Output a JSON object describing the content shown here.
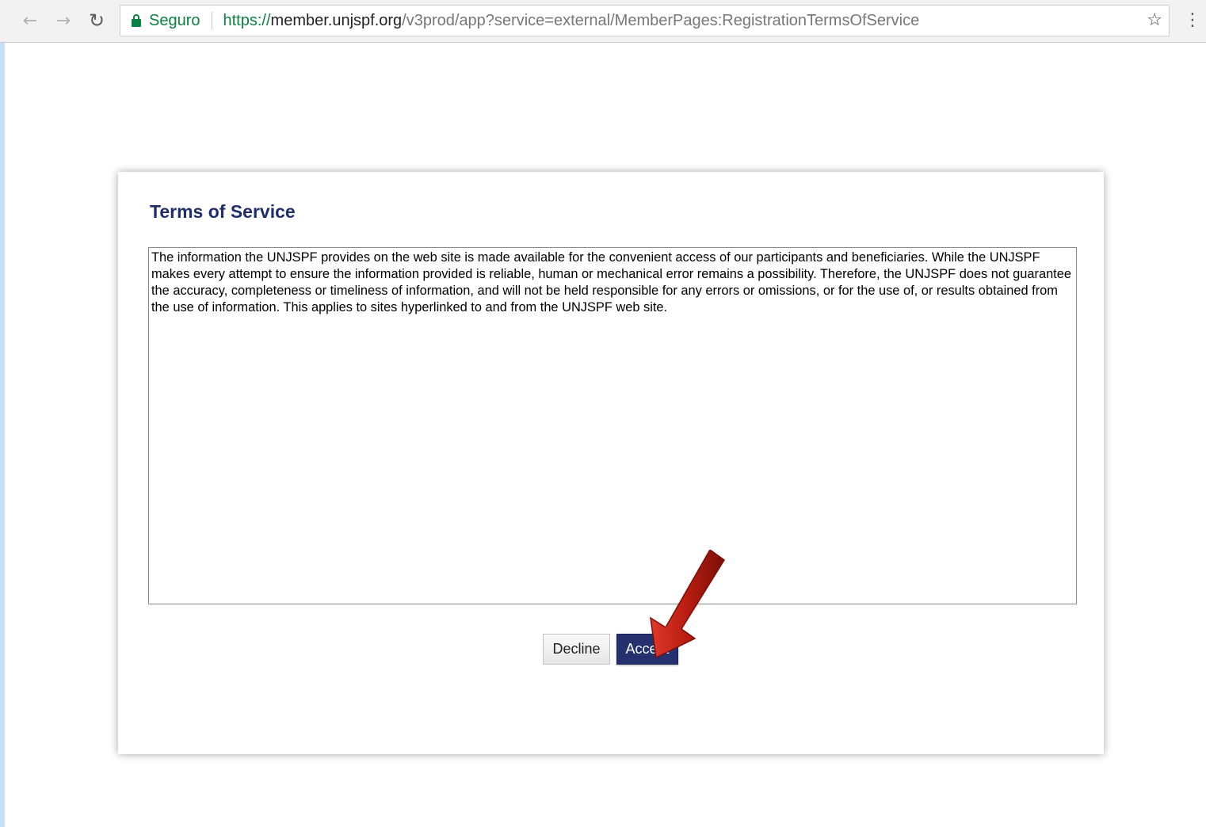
{
  "browser": {
    "secure_label": "Seguro",
    "url_scheme": "https://",
    "url_host": "member.unjspf.org",
    "url_path": "/v3prod/app?service=external/MemberPages:RegistrationTermsOfService"
  },
  "dialog": {
    "title": "Terms of Service",
    "terms_text": "The information the UNJSPF provides on the web site is made available for the convenient access of our participants and beneficiaries. While the UNJSPF makes every attempt to ensure the information provided is reliable, human or mechanical error remains a possibility. Therefore, the UNJSPF does not guarantee the accuracy, completeness or timeliness of information, and will not be held responsible for any errors or omissions, or for the use of, or results obtained from the use of information. This applies to sites hyperlinked to and from the UNJSPF web site.",
    "decline_label": "Decline",
    "accept_label": "Accept"
  },
  "icons": {
    "back": "back-arrow-icon",
    "forward": "forward-arrow-icon",
    "reload": "reload-icon",
    "lock": "lock-icon",
    "star": "star-icon",
    "menu": "menu-dots-icon",
    "annotation": "red-arrow-icon"
  },
  "colors": {
    "accent": "#25316f",
    "title": "#1f2d6b",
    "secure": "#0b8043",
    "annotation_arrow": "#b81c10"
  }
}
